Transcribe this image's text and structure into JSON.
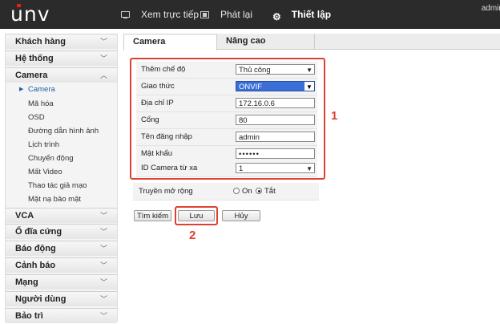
{
  "header": {
    "logo": "unv",
    "nav": [
      {
        "label": "Xem trực tiếp",
        "icon": "monitor-icon"
      },
      {
        "label": "Phát lại",
        "icon": "film-icon"
      },
      {
        "label": "Thiết lập",
        "icon": "gear-icon"
      }
    ],
    "user": "admin"
  },
  "sidebar": {
    "sections": [
      {
        "label": "Khách hàng"
      },
      {
        "label": "Hệ thống"
      },
      {
        "label": "Camera"
      },
      {
        "label": "VCA"
      },
      {
        "label": "Ổ đĩa cứng"
      },
      {
        "label": "Báo động"
      },
      {
        "label": "Cảnh báo"
      },
      {
        "label": "Mạng"
      },
      {
        "label": "Người dùng"
      },
      {
        "label": "Bảo trì"
      }
    ],
    "camera_items": [
      {
        "label": "Camera"
      },
      {
        "label": "Mã hóa"
      },
      {
        "label": "OSD"
      },
      {
        "label": "Đường dẫn hình ảnh"
      },
      {
        "label": "Lịch trình"
      },
      {
        "label": "Chuyển động"
      },
      {
        "label": "Mất Video"
      },
      {
        "label": "Thao tác giả mạo"
      },
      {
        "label": "Mặt nạ bảo mật"
      }
    ]
  },
  "tabs": [
    {
      "label": "Camera"
    },
    {
      "label": "Nâng cao"
    }
  ],
  "form": {
    "mode_label": "Thêm chế độ",
    "mode_value": "Thủ công",
    "protocol_label": "Giao thức",
    "protocol_value": "ONVIF",
    "ip_label": "Địa chỉ IP",
    "ip_value": "172.16.0.6",
    "port_label": "Cổng",
    "port_value": "80",
    "user_label": "Tên đăng nhập",
    "user_value": "admin",
    "pass_label": "Mật khẩu",
    "pass_value": "••••••",
    "remote_label": "ID Camera từ xa",
    "remote_value": "1",
    "ext_label": "Truyền mở rộng",
    "ext_on": "On",
    "ext_off": "Tắt"
  },
  "buttons": {
    "search": "Tìm kiếm",
    "save": "Lưu",
    "cancel": "Hủy"
  },
  "annotations": {
    "one": "1",
    "two": "2"
  },
  "colors": {
    "highlight": "#e04030",
    "topbar": "#2b2b2b",
    "select_blue": "#3a6fd8"
  }
}
